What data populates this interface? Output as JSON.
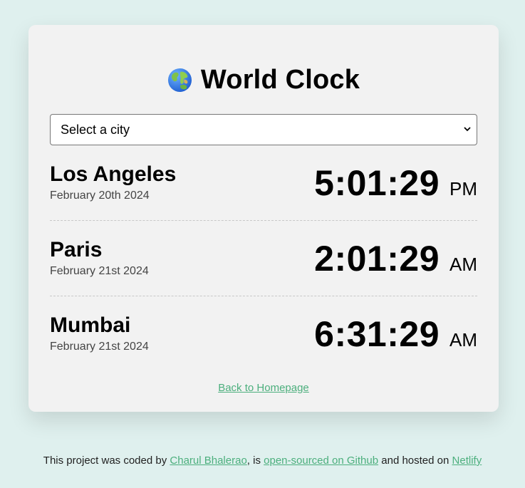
{
  "header": {
    "title": "World Clock",
    "icon": "globe-icon"
  },
  "city_select": {
    "selected": "Select a city",
    "options": [
      "Select a city"
    ]
  },
  "cities": [
    {
      "name": "Los Angeles",
      "date": "February 20th 2024",
      "time": "5:01:29",
      "ampm": "PM"
    },
    {
      "name": "Paris",
      "date": "February 21st 2024",
      "time": "2:01:29",
      "ampm": "AM"
    },
    {
      "name": "Mumbai",
      "date": "February 21st 2024",
      "time": "6:31:29",
      "ampm": "AM"
    }
  ],
  "back_link": "Back to Homepage",
  "footer": {
    "prefix": "This project was coded by ",
    "author": "Charul Bhalerao",
    "mid1": ", is ",
    "repo_link": "open-sourced on Github",
    "mid2": " and hosted on ",
    "host_link": "Netlify"
  },
  "colors": {
    "page_background": "#dff0ee",
    "card_background": "#f2f2f2",
    "link": "#4caf7d"
  }
}
